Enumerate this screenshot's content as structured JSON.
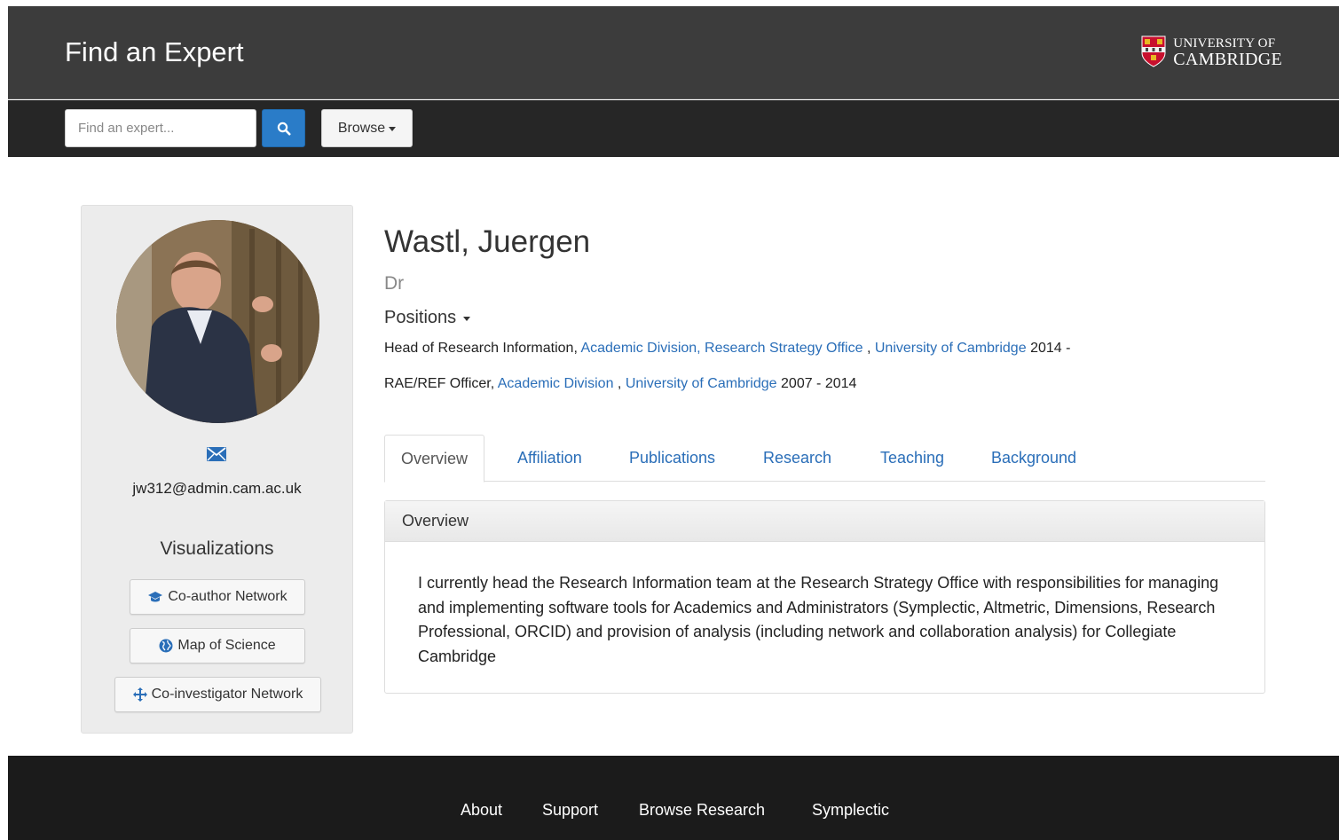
{
  "header": {
    "title": "Find an Expert",
    "university_line1": "UNIVERSITY OF",
    "university_line2": "CAMBRIDGE"
  },
  "search": {
    "placeholder": "Find an expert...",
    "browse_label": "Browse"
  },
  "profile": {
    "email": "jw312@admin.cam.ac.uk",
    "visualizations_title": "Visualizations",
    "viz_buttons": [
      "Co-author Network",
      "Map of Science",
      "Co-investigator Network"
    ],
    "name": "Wastl, Juergen",
    "honorific": "Dr",
    "positions_label": "Positions",
    "positions": [
      {
        "title": "Head of Research Information,",
        "dept": "Academic Division, Research Strategy Office",
        "sep": ",",
        "org": "University of Cambridge",
        "years": "2014 -"
      },
      {
        "title": "RAE/REF Officer,",
        "dept": "Academic Division",
        "sep": ",",
        "org": "University of Cambridge",
        "years": "2007 - 2014"
      }
    ]
  },
  "tabs": [
    "Overview",
    "Affiliation",
    "Publications",
    "Research",
    "Teaching",
    "Background"
  ],
  "overview": {
    "heading": "Overview",
    "text": "I currently head the Research Information team at the Research Strategy Office with responsibilities for managing and implementing software tools for Academics and Administrators (Symplectic, Altmetric, Dimensions, Research Professional, ORCID) and provision of analysis (including network and collaboration analysis) for Collegiate Cambridge"
  },
  "footer": {
    "links": [
      "About",
      "Support",
      "Browse Research",
      "Symplectic"
    ]
  },
  "colors": {
    "link": "#2a6eb8",
    "search_button": "#2a7cc8",
    "header_bg": "#3c3c3c",
    "footer_bg": "#1b1b1b"
  }
}
